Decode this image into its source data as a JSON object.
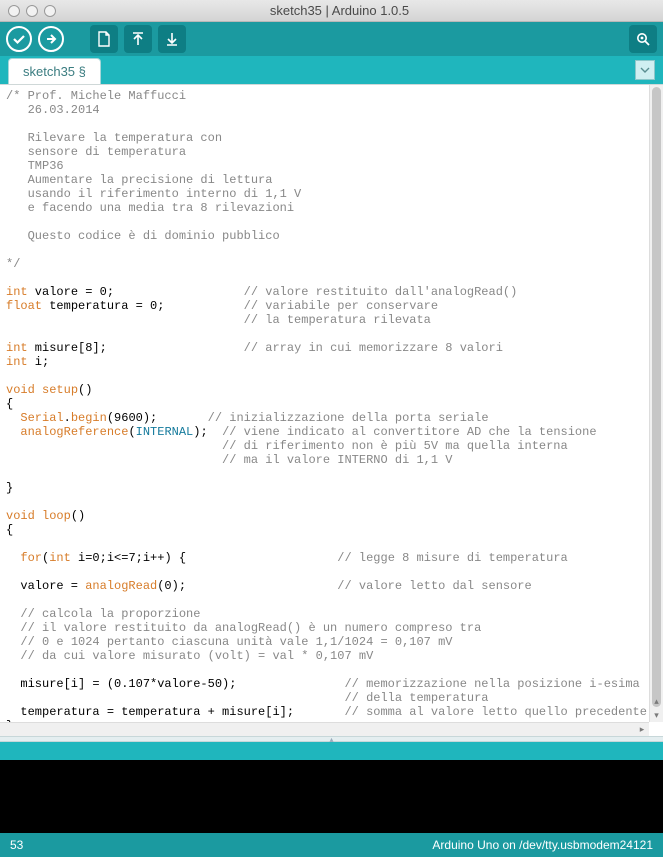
{
  "window": {
    "title": "sketch35 | Arduino 1.0.5"
  },
  "tabs": {
    "active": "sketch35 §"
  },
  "status": {
    "line": "53",
    "board": "Arduino Uno on /dev/tty.usbmodem24121"
  },
  "code": {
    "lines": [
      {
        "t": "cm",
        "s": "/* Prof. Michele Maffucci"
      },
      {
        "t": "cm",
        "s": "   26.03.2014"
      },
      {
        "t": "cm",
        "s": ""
      },
      {
        "t": "cm",
        "s": "   Rilevare la temperatura con"
      },
      {
        "t": "cm",
        "s": "   sensore di temperatura"
      },
      {
        "t": "cm",
        "s": "   TMP36"
      },
      {
        "t": "cm",
        "s": "   Aumentare la precisione di lettura"
      },
      {
        "t": "cm",
        "s": "   usando il riferimento interno di 1,1 V"
      },
      {
        "t": "cm",
        "s": "   e facendo una media tra 8 rilevazioni"
      },
      {
        "t": "cm",
        "s": ""
      },
      {
        "t": "cm",
        "s": "   Questo codice è di dominio pubblico"
      },
      {
        "t": "cm",
        "s": ""
      },
      {
        "t": "cm",
        "s": "*/"
      },
      {
        "t": "bl",
        "s": ""
      },
      {
        "t": "mx",
        "parts": [
          {
            "c": "kw",
            "s": "int"
          },
          {
            "c": "",
            "s": " valore = 0;                  "
          },
          {
            "c": "cm",
            "s": "// valore restituito dall'analogRead()"
          }
        ]
      },
      {
        "t": "mx",
        "parts": [
          {
            "c": "kw",
            "s": "float"
          },
          {
            "c": "",
            "s": " temperatura = 0;           "
          },
          {
            "c": "cm",
            "s": "// variabile per conservare"
          }
        ]
      },
      {
        "t": "mx",
        "parts": [
          {
            "c": "",
            "s": "                                 "
          },
          {
            "c": "cm",
            "s": "// la temperatura rilevata"
          }
        ]
      },
      {
        "t": "bl",
        "s": ""
      },
      {
        "t": "mx",
        "parts": [
          {
            "c": "kw",
            "s": "int"
          },
          {
            "c": "",
            "s": " misure[8];                   "
          },
          {
            "c": "cm",
            "s": "// array in cui memorizzare 8 valori"
          }
        ]
      },
      {
        "t": "mx",
        "parts": [
          {
            "c": "kw",
            "s": "int"
          },
          {
            "c": "",
            "s": " i;"
          }
        ]
      },
      {
        "t": "bl",
        "s": ""
      },
      {
        "t": "mx",
        "parts": [
          {
            "c": "kw",
            "s": "void"
          },
          {
            "c": "",
            "s": " "
          },
          {
            "c": "fn",
            "s": "setup"
          },
          {
            "c": "",
            "s": "()"
          }
        ]
      },
      {
        "t": "",
        "s": "{"
      },
      {
        "t": "mx",
        "parts": [
          {
            "c": "",
            "s": "  "
          },
          {
            "c": "bi",
            "s": "Serial"
          },
          {
            "c": "",
            "s": "."
          },
          {
            "c": "bi",
            "s": "begin"
          },
          {
            "c": "",
            "s": "(9600);       "
          },
          {
            "c": "cm",
            "s": "// inizializzazione della porta seriale"
          }
        ]
      },
      {
        "t": "mx",
        "parts": [
          {
            "c": "",
            "s": "  "
          },
          {
            "c": "bi",
            "s": "analogReference"
          },
          {
            "c": "",
            "s": "("
          },
          {
            "c": "cn",
            "s": "INTERNAL"
          },
          {
            "c": "",
            "s": ");  "
          },
          {
            "c": "cm",
            "s": "// viene indicato al convertitore AD che la tensione"
          }
        ]
      },
      {
        "t": "mx",
        "parts": [
          {
            "c": "",
            "s": "                              "
          },
          {
            "c": "cm",
            "s": "// di riferimento non è più 5V ma quella interna"
          }
        ]
      },
      {
        "t": "mx",
        "parts": [
          {
            "c": "",
            "s": "                              "
          },
          {
            "c": "cm",
            "s": "// ma il valore INTERNO di 1,1 V"
          }
        ]
      },
      {
        "t": "bl",
        "s": ""
      },
      {
        "t": "",
        "s": "}"
      },
      {
        "t": "bl",
        "s": ""
      },
      {
        "t": "mx",
        "parts": [
          {
            "c": "kw",
            "s": "void"
          },
          {
            "c": "",
            "s": " "
          },
          {
            "c": "fn",
            "s": "loop"
          },
          {
            "c": "",
            "s": "()"
          }
        ]
      },
      {
        "t": "",
        "s": "{"
      },
      {
        "t": "bl",
        "s": ""
      },
      {
        "t": "mx",
        "parts": [
          {
            "c": "",
            "s": "  "
          },
          {
            "c": "kw",
            "s": "for"
          },
          {
            "c": "",
            "s": "("
          },
          {
            "c": "kw",
            "s": "int"
          },
          {
            "c": "",
            "s": " i=0;i<=7;i++) {                     "
          },
          {
            "c": "cm",
            "s": "// legge 8 misure di temperatura"
          }
        ]
      },
      {
        "t": "bl",
        "s": ""
      },
      {
        "t": "mx",
        "parts": [
          {
            "c": "",
            "s": "  valore = "
          },
          {
            "c": "bi",
            "s": "analogRead"
          },
          {
            "c": "",
            "s": "(0);                     "
          },
          {
            "c": "cm",
            "s": "// valore letto dal sensore"
          }
        ]
      },
      {
        "t": "bl",
        "s": ""
      },
      {
        "t": "mx",
        "parts": [
          {
            "c": "",
            "s": "  "
          },
          {
            "c": "cm",
            "s": "// calcola la proporzione"
          }
        ]
      },
      {
        "t": "mx",
        "parts": [
          {
            "c": "",
            "s": "  "
          },
          {
            "c": "cm",
            "s": "// il valore restituito da analogRead() è un numero compreso tra"
          }
        ]
      },
      {
        "t": "mx",
        "parts": [
          {
            "c": "",
            "s": "  "
          },
          {
            "c": "cm",
            "s": "// 0 e 1024 pertanto ciascuna unità vale 1,1/1024 = 0,107 mV"
          }
        ]
      },
      {
        "t": "mx",
        "parts": [
          {
            "c": "",
            "s": "  "
          },
          {
            "c": "cm",
            "s": "// da cui valore misurato (volt) = val * 0,107 mV"
          }
        ]
      },
      {
        "t": "bl",
        "s": ""
      },
      {
        "t": "mx",
        "parts": [
          {
            "c": "",
            "s": "  misure[i] = (0.107*valore-50);               "
          },
          {
            "c": "cm",
            "s": "// memorizzazione nella posizione i-esima"
          }
        ]
      },
      {
        "t": "mx",
        "parts": [
          {
            "c": "",
            "s": "                                               "
          },
          {
            "c": "cm",
            "s": "// della temperatura"
          }
        ]
      },
      {
        "t": "mx",
        "parts": [
          {
            "c": "",
            "s": "  temperatura = temperatura + misure[i];       "
          },
          {
            "c": "cm",
            "s": "// somma al valore letto quello precedente"
          }
        ]
      },
      {
        "t": "",
        "s": "}"
      }
    ]
  }
}
